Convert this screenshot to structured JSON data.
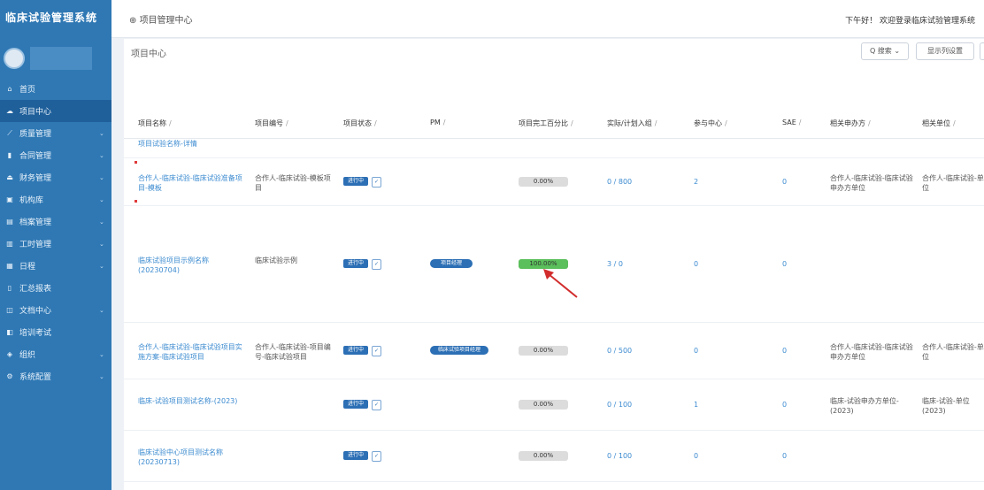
{
  "app": {
    "title": "临床试验管理系统"
  },
  "sidebar": {
    "items": [
      {
        "label": "首页",
        "icon": "home-icon",
        "glyph": "⌂",
        "arrow": ""
      },
      {
        "label": "项目中心",
        "icon": "cloud-icon",
        "glyph": "☁",
        "arrow": ""
      },
      {
        "label": "质量管理",
        "icon": "chart-icon",
        "glyph": "⟋",
        "arrow": "⌄"
      },
      {
        "label": "合同管理",
        "icon": "contract-icon",
        "glyph": "▮",
        "arrow": "⌄"
      },
      {
        "label": "财务管理",
        "icon": "finance-icon",
        "glyph": "⏏",
        "arrow": "⌄"
      },
      {
        "label": "机构库",
        "icon": "institution-icon",
        "glyph": "▣",
        "arrow": "⌄"
      },
      {
        "label": "档案管理",
        "icon": "archive-icon",
        "glyph": "▤",
        "arrow": "⌄"
      },
      {
        "label": "工时管理",
        "icon": "timesheet-icon",
        "glyph": "▥",
        "arrow": "⌄"
      },
      {
        "label": "日程",
        "icon": "calendar-icon",
        "glyph": "▦",
        "arrow": "⌄"
      },
      {
        "label": "汇总报表",
        "icon": "report-icon",
        "glyph": "▯",
        "arrow": ""
      },
      {
        "label": "文档中心",
        "icon": "document-icon",
        "glyph": "◫",
        "arrow": "⌄"
      },
      {
        "label": "培训考试",
        "icon": "training-icon",
        "glyph": "◧",
        "arrow": ""
      },
      {
        "label": "组织",
        "icon": "org-icon",
        "glyph": "◈",
        "arrow": "⌄"
      },
      {
        "label": "系统配置",
        "icon": "settings-icon",
        "glyph": "⚙",
        "arrow": "⌄"
      }
    ]
  },
  "topbar": {
    "breadcrumb": "项目管理中心",
    "greeting": "下午好！ 欢迎登录临床试验管理系统"
  },
  "panel": {
    "title": "项目中心",
    "search_label": "Q 搜索 ⌄",
    "settings_label": "显示列设置"
  },
  "table": {
    "headers": [
      "项目名称",
      "项目编号",
      "项目状态",
      "PM",
      "项目完工百分比",
      "实际/计划入组",
      "参与中心",
      "SAE",
      "相关申办方",
      "相关单位"
    ],
    "rows": [
      {
        "name": "项目试验名称-详情",
        "code": "",
        "status": "",
        "check": "",
        "pm": "",
        "progress": "",
        "progress_pct": 0,
        "enroll": "",
        "centers": "",
        "sae": "",
        "sponsor": "",
        "unit": ""
      },
      {
        "name": "合作人-临床试验-临床试验准备项目-模板",
        "code": "合作人-临床试验-模板项目",
        "status": "进行中",
        "check": "✓",
        "pm": "",
        "progress": "0.00%",
        "progress_pct": 0,
        "enroll": "0 / 800",
        "centers": "2",
        "sae": "0",
        "sponsor": "合作人-临床试验-临床试验申办方单位",
        "unit": "合作人-临床试验-单位"
      },
      {
        "name": "临床试验项目示例名称(20230704)",
        "code": "临床试验示例",
        "status": "进行中",
        "check": "✓",
        "pm": "项目经理",
        "progress": "100.00%",
        "progress_pct": 100,
        "enroll": "3 / 0",
        "centers": "0",
        "sae": "0",
        "sponsor": "",
        "unit": ""
      },
      {
        "name": "合作人-临床试验-临床试验项目实施方案-临床试验项目",
        "code": "合作人-临床试验-项目编号-临床试验项目",
        "status": "进行中",
        "check": "✓",
        "pm": "临床试验项目经理",
        "progress": "0.00%",
        "progress_pct": 0,
        "enroll": "0 / 500",
        "centers": "0",
        "sae": "0",
        "sponsor": "合作人-临床试验-临床试验申办方单位",
        "unit": "合作人-临床试验-单位"
      },
      {
        "name": "临床-试验项目测试名称-(2023)",
        "code": "",
        "status": "进行中",
        "check": "✓",
        "pm": "",
        "progress": "0.00%",
        "progress_pct": 0,
        "enroll": "0 / 100",
        "centers": "1",
        "sae": "0",
        "sponsor": "临床-试验申办方单位-(2023)",
        "unit": "临床-试验-单位(2023)"
      },
      {
        "name": "临床试验中心项目测试名称(20230713)",
        "code": "",
        "status": "进行中",
        "check": "✓",
        "pm": "",
        "progress": "0.00%",
        "progress_pct": 0,
        "enroll": "0 / 100",
        "centers": "0",
        "sae": "0",
        "sponsor": "",
        "unit": ""
      }
    ]
  }
}
